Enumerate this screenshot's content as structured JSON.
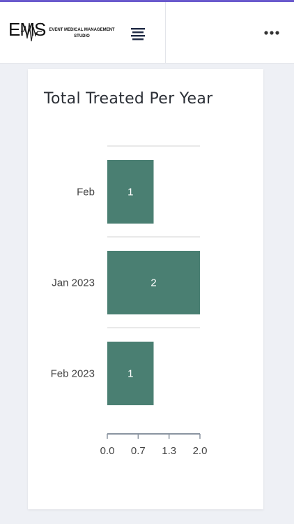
{
  "header": {
    "logo_text": "EMS",
    "logo_subtitle_line1": "EVENT MEDICAL MANAGEMENT",
    "logo_subtitle_line2": "STUDIO",
    "menu_icon": "hamburger-icon",
    "more_icon": "more-horizontal-icon"
  },
  "card": {
    "title": "Total Treated Per Year"
  },
  "chart_data": {
    "type": "bar",
    "orientation": "horizontal",
    "title": "Total Treated Per Year",
    "categories": [
      "Feb",
      "Jan 2023",
      "Feb 2023"
    ],
    "values": [
      1,
      2,
      1
    ],
    "data_labels": [
      "1",
      "2",
      "1"
    ],
    "xlim": [
      0,
      2
    ],
    "x_ticks": [
      "0.0",
      "0.7",
      "1.3",
      "2.0"
    ],
    "bar_color": "#4a7f72",
    "grid": true
  }
}
